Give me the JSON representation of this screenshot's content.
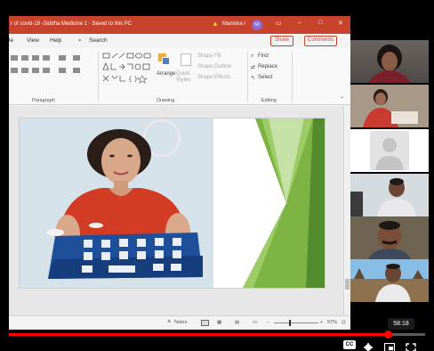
{
  "window": {
    "title": "r of covid-19 -Siddha Medicine 1 · Saved to this PC",
    "user_name": "Manisha I",
    "user_initials": "MI"
  },
  "menu": {
    "items": [
      "le",
      "View",
      "Help"
    ],
    "search_label": "Search",
    "share_label": "Share",
    "comments_label": "Comments"
  },
  "ribbon": {
    "groups": [
      "Paragraph",
      "Drawing",
      "Editing"
    ],
    "arrange_label": "Arrange",
    "quick_styles_label": "Quick Styles",
    "shape_fill_label": "Shape Fill",
    "shape_outline_label": "Shape Outline",
    "shape_effects_label": "Shape Effects",
    "find_label": "Find",
    "replace_label": "Replace",
    "select_label": "Select"
  },
  "statusbar": {
    "notes_label": "Notes",
    "zoom_label": "57%"
  },
  "player": {
    "time": "58:18",
    "progress_fraction": 0.91,
    "cc_label": "CC"
  },
  "colors": {
    "accent": "#c8432b",
    "progress": "#ff0000",
    "slide_green": "#7cb342"
  }
}
